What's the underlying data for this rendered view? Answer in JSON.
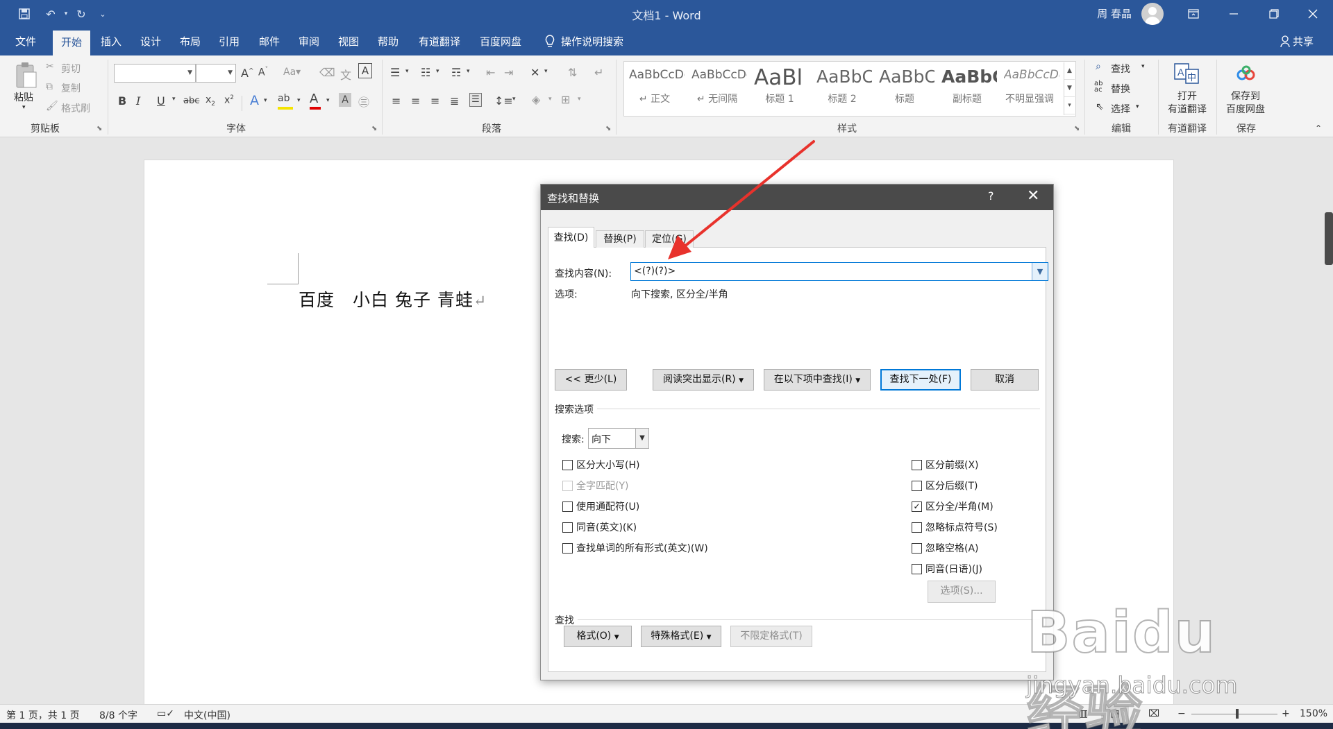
{
  "app": {
    "title": "文档1  -  Word",
    "user": "周 春晶",
    "share": "共享"
  },
  "colors": {
    "brand": "#2b579a",
    "dialog_title_bg": "#4a4a4a",
    "accent_blue": "#0078d7",
    "annotation_arrow": "#e8322c"
  },
  "tabs": [
    "文件",
    "开始",
    "插入",
    "设计",
    "布局",
    "引用",
    "邮件",
    "审阅",
    "视图",
    "帮助",
    "有道翻译",
    "百度网盘",
    "操作说明搜索"
  ],
  "active_tab": "开始",
  "ribbon": {
    "clipboard": {
      "label": "剪贴板",
      "paste": "粘贴",
      "cut": "剪切",
      "copy": "复制",
      "format_painter": "格式刷"
    },
    "font": {
      "label": "字体",
      "font_name": "",
      "font_size": ""
    },
    "paragraph": {
      "label": "段落"
    },
    "styles": {
      "label": "样式",
      "items": [
        {
          "preview": "AaBbCcDc",
          "name": "↵ 正文"
        },
        {
          "preview": "AaBbCcDc",
          "name": "↵ 无间隔"
        },
        {
          "preview": "AaBl",
          "name": "标题 1"
        },
        {
          "preview": "AaBbC",
          "name": "标题 2"
        },
        {
          "preview": "AaBbC",
          "name": "标题"
        },
        {
          "preview": "AaBbC",
          "name": "副标题"
        },
        {
          "preview": "AaBbCcDc",
          "name": "不明显强调"
        }
      ]
    },
    "editing": {
      "label": "编辑",
      "find": "查找",
      "replace": "替换",
      "select": "选择"
    },
    "youdao": {
      "label": "有道翻译",
      "open_line1": "打开",
      "open_line2": "有道翻译"
    },
    "save": {
      "label": "保存",
      "line1": "保存到",
      "line2": "百度网盘"
    }
  },
  "document": {
    "text": "百度　小白 兔子 青蛙"
  },
  "statusbar": {
    "page": "第 1 页，共 1 页",
    "words": "8/8 个字",
    "language": "中文(中国)",
    "zoom": "150%"
  },
  "dialog": {
    "title": "查找和替换",
    "help": "?",
    "tabs": [
      "查找(D)",
      "替换(P)",
      "定位(G)"
    ],
    "active_tab": "查找(D)",
    "find_label": "查找内容(N):",
    "find_value": "<(?)(?)>",
    "options_label": "选项:",
    "options_value": "向下搜索, 区分全/半角",
    "buttons": {
      "less": "<< 更少(L)",
      "reading_highlight": "阅读突出显示(R)",
      "find_in": "在以下项中查找(I)",
      "find_next": "查找下一处(F)",
      "cancel": "取消"
    },
    "search_options_title": "搜索选项",
    "search_label": "搜索:",
    "search_value": "向下",
    "left_options": [
      {
        "label": "区分大小写(H)",
        "checked": false,
        "disabled": false
      },
      {
        "label": "全字匹配(Y)",
        "checked": false,
        "disabled": true
      },
      {
        "label": "使用通配符(U)",
        "checked": false,
        "disabled": false
      },
      {
        "label": "同音(英文)(K)",
        "checked": false,
        "disabled": false
      },
      {
        "label": "查找单词的所有形式(英文)(W)",
        "checked": false,
        "disabled": false
      }
    ],
    "right_options": [
      {
        "label": "区分前缀(X)",
        "checked": false
      },
      {
        "label": "区分后缀(T)",
        "checked": false
      },
      {
        "label": "区分全/半角(M)",
        "checked": true
      },
      {
        "label": "忽略标点符号(S)",
        "checked": false
      },
      {
        "label": "忽略空格(A)",
        "checked": false
      },
      {
        "label": "同音(日语)(J)",
        "checked": false
      }
    ],
    "options_button": "选项(S)...",
    "find_section_title": "查找",
    "format_button": "格式(O)",
    "special_button": "特殊格式(E)",
    "no_format_button": "不限定格式(T)"
  },
  "watermark": {
    "logo": "Baidu经验",
    "sub": "jingyan.baidu.com"
  }
}
